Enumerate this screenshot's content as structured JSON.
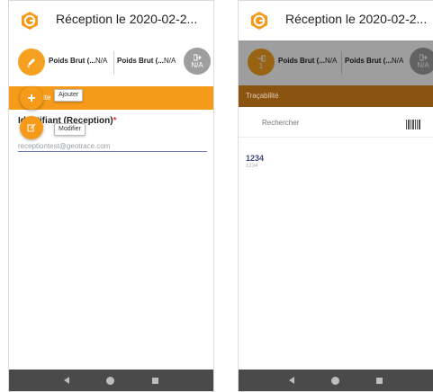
{
  "left_screen": {
    "header": {
      "title": "Réception le 2020-02-2..."
    },
    "info_row": {
      "weight1_label": "Poids Brut (...",
      "weight1_value": "N/A",
      "weight2_label": "Poids Brut (...",
      "weight2_value": "N/A",
      "exit_value": "N/A"
    },
    "orange_bar": {
      "partial_text": "ite"
    },
    "fab_add": {
      "tooltip": "Ajouter"
    },
    "fab_edit": {
      "tooltip": "Modifier"
    },
    "field": {
      "label": "Identifiant (Reception)",
      "required_mark": "*",
      "value": "receptiontest@geotrace.com"
    }
  },
  "right_screen": {
    "header": {
      "title": "Réception le 2020-02-2..."
    },
    "info_row": {
      "circle_value": "1",
      "weight1_label": "Poids Brut (...",
      "weight1_value": "N/A",
      "weight2_label": "Poids Brut (...",
      "weight2_value": "N/A",
      "exit_value": "N/A"
    },
    "section_label": "Traçabilité",
    "search": {
      "placeholder": "Rechercher"
    },
    "list": [
      {
        "title": "1234",
        "subtitle": "1234"
      }
    ]
  },
  "colors": {
    "accent_orange": "#f59a19",
    "trace_brown": "#8a5410",
    "navbar": "#4a4a4a",
    "grey_circle": "#9e9e9e"
  },
  "icons": {
    "logo": "geotrace-logo-icon",
    "pen": "pen-icon",
    "plus": "plus-icon",
    "edit": "edit-icon",
    "exit": "exit-icon",
    "entry": "entry-icon",
    "barcode": "barcode-icon"
  }
}
